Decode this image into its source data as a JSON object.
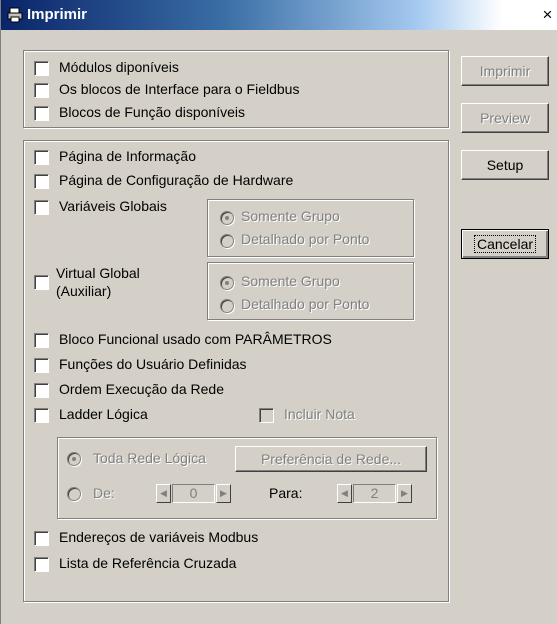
{
  "window": {
    "title": "Imprimir",
    "close": "×"
  },
  "group1": {
    "items": [
      "Módulos diponíveis",
      "Os blocos de Interface para o Fieldbus",
      "Blocos de Função disponíveis"
    ]
  },
  "group2": {
    "pagina_info": "Página de Informação",
    "pagina_config": "Página de Configuração de Hardware",
    "variaveis_globais": "Variáveis Globais",
    "virtual_global_l1": "Virtual Global",
    "virtual_global_l2": "(Auxiliar)",
    "somente_grupo": "Somente Grupo",
    "detalhado_ponto": "Detalhado por Ponto",
    "bloco_funcional": "Bloco Funcional usado com PARÂMETROS",
    "funcoes_usuario": "Funções do Usuário Definidas",
    "ordem_execucao": "Ordem Execução da Rede",
    "ladder": "Ladder Lógica",
    "incluir_nota": "Incluir Nota",
    "toda_rede": "Toda Rede Lógica",
    "preferencia": "Preferência de Rede...",
    "de": "De:",
    "de_value": "0",
    "para": "Para:",
    "para_value": "2",
    "enderecos_modbus": "Endereços de variáveis Modbus",
    "lista_referencia": "Lista de Referência Cruzada"
  },
  "buttons": {
    "imprimir": "Imprimir",
    "preview": "Preview",
    "setup": "Setup",
    "cancelar": "Cancelar"
  },
  "colors": {
    "face": "#d4d0c8",
    "title_start": "#0a246a",
    "title_end": "#a6caf0",
    "disabled_text": "#808080"
  },
  "icons": {
    "title": "printer-icon",
    "close": "close-icon"
  }
}
